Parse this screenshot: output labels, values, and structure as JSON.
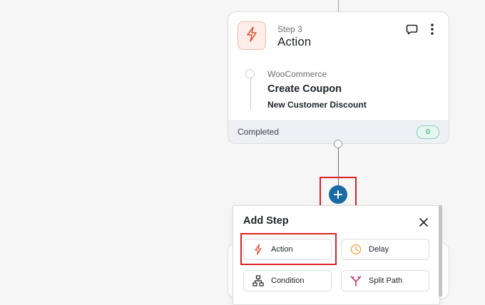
{
  "step_card": {
    "step_number": "Step 3",
    "step_title": "Action",
    "integration": "WooCommerce",
    "action_name": "Create Coupon",
    "action_detail": "New Customer Discount",
    "status": "Completed",
    "count": "0",
    "icon": "lightning-icon"
  },
  "add_step_panel": {
    "title": "Add Step",
    "options": [
      {
        "label": "Action",
        "icon": "lightning-icon"
      },
      {
        "label": "Delay",
        "icon": "clock-icon"
      },
      {
        "label": "Condition",
        "icon": "sitemap-icon"
      },
      {
        "label": "Split Path",
        "icon": "split-arrows-icon"
      }
    ]
  },
  "colors": {
    "accent_action": "#e2563b",
    "delay": "#f0a23a",
    "split": "#c2185b",
    "add_button": "#1a6aa3",
    "highlight": "#d9232b",
    "badge": "#1e8a67"
  }
}
